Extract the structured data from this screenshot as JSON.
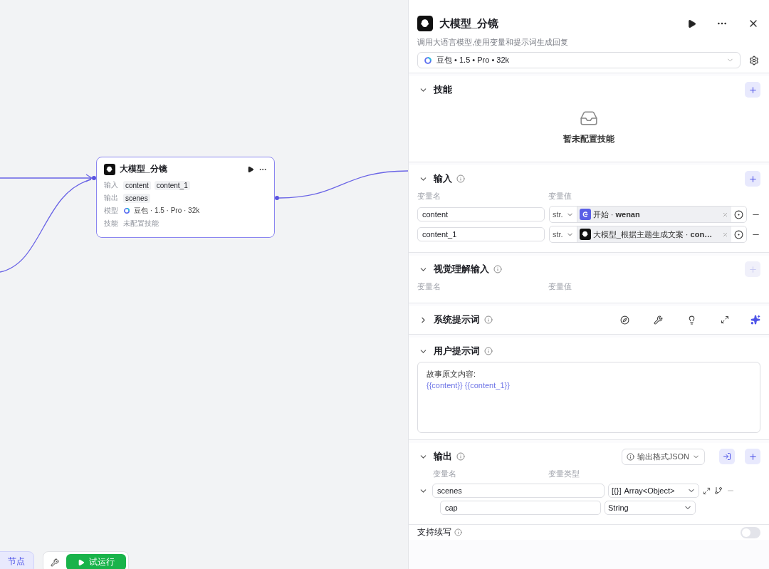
{
  "canvas": {
    "node": {
      "title": "大模型_分镜",
      "rows": [
        {
          "kind": "tags",
          "label": "输入",
          "tags": [
            "content",
            "content_1"
          ]
        },
        {
          "kind": "tags",
          "label": "输出",
          "tags": [
            "scenes"
          ]
        },
        {
          "kind": "model",
          "label": "模型",
          "text": "豆包 · 1.5 · Pro · 32k"
        },
        {
          "kind": "muted",
          "label": "技能",
          "text": "未配置技能"
        }
      ]
    },
    "toolbar": {
      "add_node": "节点",
      "test_run": "试运行"
    }
  },
  "panel": {
    "title": "大模型_分镜",
    "description": "调用大语言模型,使用变量和提示词生成回复",
    "model": "豆包 • 1.5 • Pro • 32k",
    "sections": [
      {
        "kind": "skills",
        "title": "技能",
        "expanded": true,
        "info": false,
        "add_disabled": false,
        "empty_text": "暂未配置技能"
      },
      {
        "kind": "inputs",
        "title": "输入",
        "expanded": true,
        "info": true,
        "add_disabled": false,
        "headers": [
          "变量名",
          "变量值"
        ],
        "rows": [
          {
            "name": "content",
            "type": "str.",
            "kind": "start",
            "ref": "开始 · **wenan**"
          },
          {
            "name": "content_1",
            "type": "str.",
            "kind": "llm",
            "ref": "大模型_根据主题生成文案 · **con…**"
          }
        ]
      },
      {
        "kind": "inputs",
        "title": "视觉理解输入",
        "expanded": true,
        "info": true,
        "add_disabled": true,
        "headers": [
          "变量名",
          "变量值"
        ]
      },
      {
        "kind": "system",
        "title": "系统提示词",
        "expanded": false,
        "info": true
      },
      {
        "kind": "prompt",
        "title": "用户提示词",
        "expanded": true,
        "info": true,
        "lines": [
          {
            "kind": "text",
            "text": "故事原文内容:"
          },
          {
            "kind": "variable",
            "text": "{{content}} {{content_1}}"
          }
        ]
      },
      {
        "kind": "output",
        "title": "输出",
        "expanded": true,
        "info": true,
        "add_disabled": false,
        "format": "输出格式JSON",
        "headers": [
          "变量名",
          "变量类型"
        ],
        "rows": [
          {
            "name": "scenes",
            "type_icon": "[{}]",
            "type": "Array<Object>",
            "expanded": true,
            "children": [
              {
                "name": "cap",
                "type": "String"
              }
            ]
          }
        ]
      }
    ],
    "continue": {
      "label": "支持续写",
      "on": false
    }
  }
}
